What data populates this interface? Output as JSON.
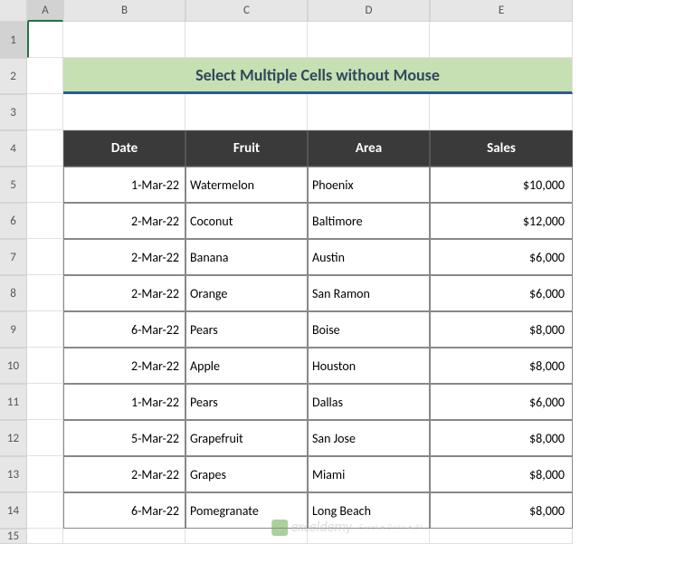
{
  "columns": [
    "A",
    "B",
    "C",
    "D",
    "E"
  ],
  "rows": [
    "1",
    "2",
    "3",
    "4",
    "5",
    "6",
    "7",
    "8",
    "9",
    "10",
    "11",
    "12",
    "13",
    "14",
    "15"
  ],
  "title": "Select Multiple Cells without Mouse",
  "headers": {
    "date": "Date",
    "fruit": "Fruit",
    "area": "Area",
    "sales": "Sales"
  },
  "chart_data": {
    "type": "table",
    "columns": [
      "Date",
      "Fruit",
      "Area",
      "Sales"
    ],
    "rows": [
      {
        "date": "1-Mar-22",
        "fruit": "Watermelon",
        "area": "Phoenix",
        "sales": "$10,000"
      },
      {
        "date": "2-Mar-22",
        "fruit": "Coconut",
        "area": "Baltimore",
        "sales": "$12,000"
      },
      {
        "date": "2-Mar-22",
        "fruit": "Banana",
        "area": "Austin",
        "sales": "$6,000"
      },
      {
        "date": "2-Mar-22",
        "fruit": "Orange",
        "area": "San Ramon",
        "sales": "$6,000"
      },
      {
        "date": "6-Mar-22",
        "fruit": "Pears",
        "area": "Boise",
        "sales": "$8,000"
      },
      {
        "date": "2-Mar-22",
        "fruit": "Apple",
        "area": "Houston",
        "sales": "$8,000"
      },
      {
        "date": "1-Mar-22",
        "fruit": "Pears",
        "area": "Dallas",
        "sales": "$6,000"
      },
      {
        "date": "5-Mar-22",
        "fruit": "Grapefruit",
        "area": "San Jose",
        "sales": "$8,000"
      },
      {
        "date": "2-Mar-22",
        "fruit": "Grapes",
        "area": "Miami",
        "sales": "$8,000"
      },
      {
        "date": "6-Mar-22",
        "fruit": "Pomegranate",
        "area": "Long Beach",
        "sales": "$8,000"
      }
    ]
  },
  "watermark": "exceldemy",
  "watermark_sub": "Excel • Data • BI"
}
